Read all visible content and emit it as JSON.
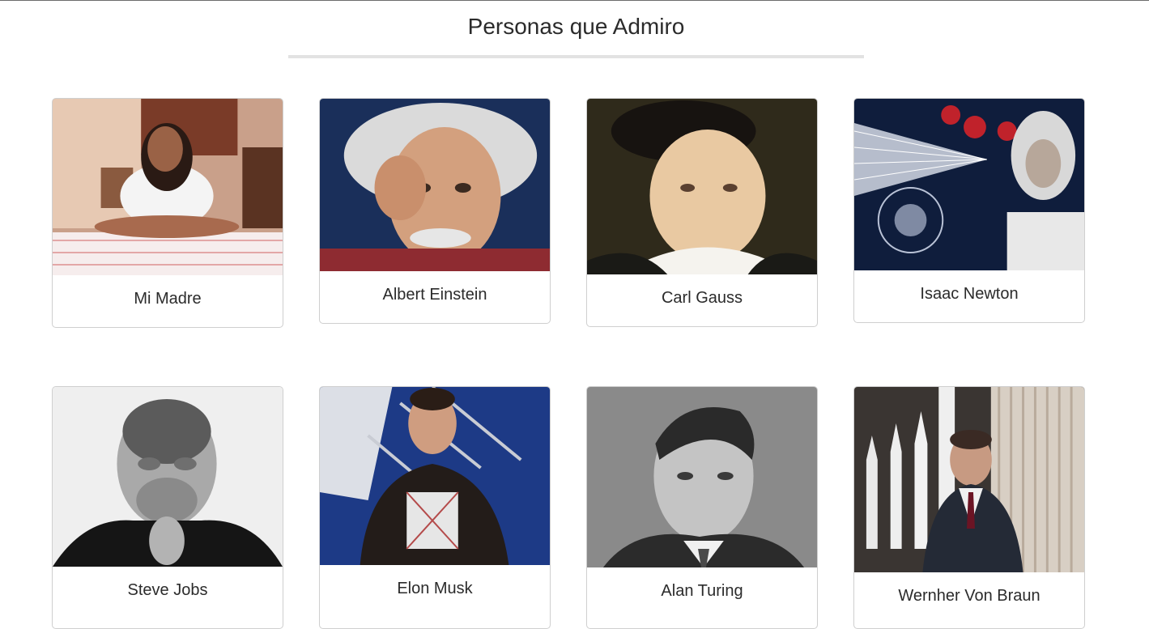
{
  "page": {
    "title": "Personas que Admiro"
  },
  "cards": [
    {
      "name": "Mi Madre"
    },
    {
      "name": "Albert Einstein"
    },
    {
      "name": "Carl Gauss"
    },
    {
      "name": "Isaac Newton"
    },
    {
      "name": "Steve Jobs"
    },
    {
      "name": "Elon Musk"
    },
    {
      "name": "Alan Turing"
    },
    {
      "name": "Wernher Von Braun"
    }
  ]
}
